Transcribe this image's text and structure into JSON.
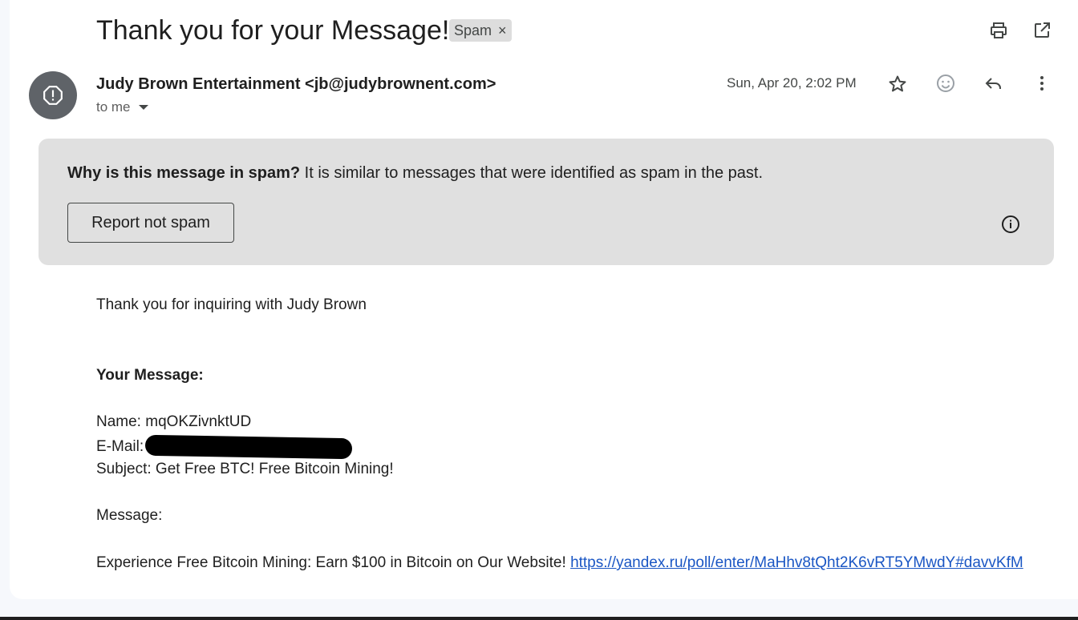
{
  "email": {
    "subject": "Thank you for your Message!",
    "label": "Spam",
    "sender": "Judy Brown Entertainment <jb@judybrownent.com>",
    "recipient": "to me",
    "date": "Sun, Apr 20, 2:02 PM"
  },
  "spam_banner": {
    "question": "Why is this message in spam?",
    "explanation": " It is similar to messages that were identified as spam in the past.",
    "report_button": "Report not spam"
  },
  "body": {
    "greeting": "Thank you for inquiring with Judy Brown",
    "section_heading": "Your Message:",
    "name_line": "Name: mqOKZivnktUD",
    "email_label": "E-Mail:",
    "subject_line": "Subject: Get Free BTC! Free Bitcoin Mining!",
    "message_label": "Message:",
    "message_text": "Experience Free Bitcoin Mining: Earn $100 in Bitcoin on Our Website! ",
    "message_link": "https://yandex.ru/poll/enter/MaHhv8tQht2K6vRT5YMwdY#davvKfM"
  },
  "icons": [
    "print-icon",
    "open-in-new-window-icon",
    "spam-alert-icon",
    "star-icon",
    "emoji-icon",
    "reply-icon",
    "more-vert-icon",
    "info-icon",
    "close-icon",
    "chevron-down-icon"
  ]
}
